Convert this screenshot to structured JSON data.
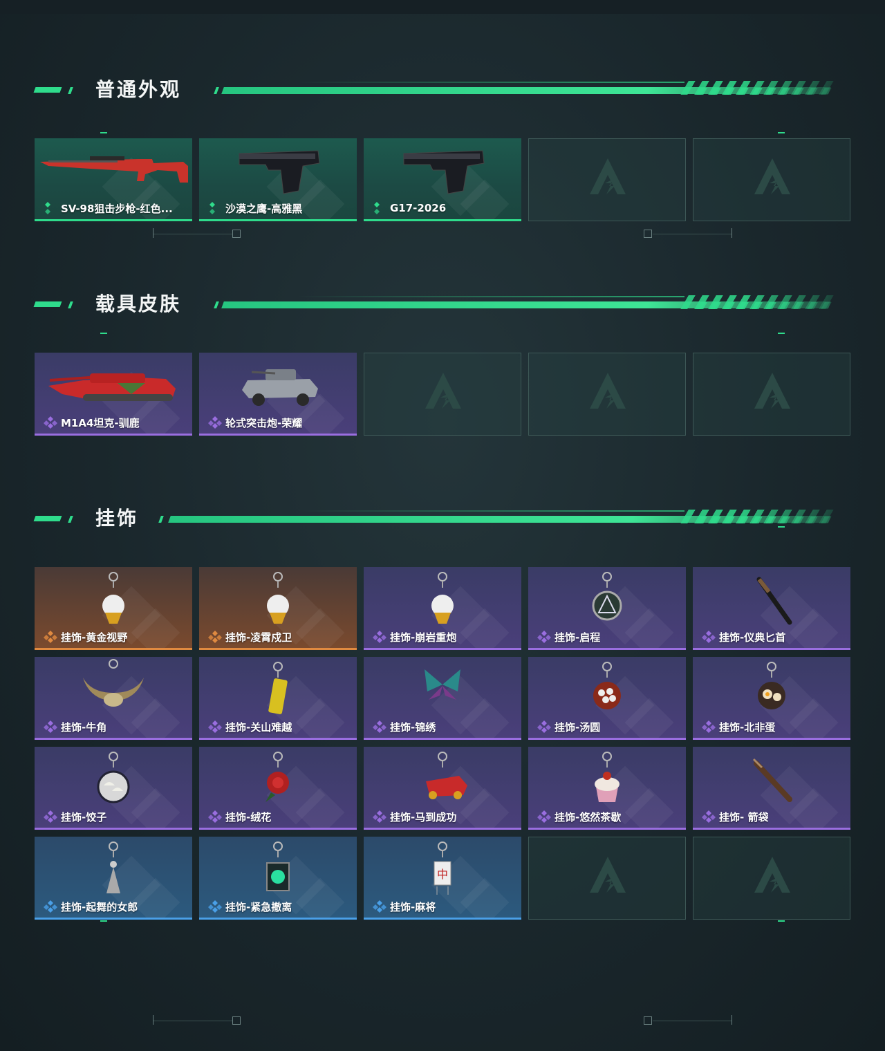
{
  "sections": [
    {
      "title": "普通外观",
      "cards": [
        {
          "label": "SV-98狙击步枪-红色...",
          "rarity": "green",
          "icon": "sniper-rifle-icon"
        },
        {
          "label": "沙漠之鹰-高雅黑",
          "rarity": "green",
          "icon": "pistol-icon"
        },
        {
          "label": "G17-2026",
          "rarity": "green",
          "icon": "pistol-icon"
        }
      ]
    },
    {
      "title": "载具皮肤",
      "cards": [
        {
          "label": "M1A4坦克-驯鹿",
          "rarity": "purple",
          "icon": "tank-icon"
        },
        {
          "label": "轮式突击炮-荣耀",
          "rarity": "purple",
          "icon": "armored-car-icon"
        }
      ]
    },
    {
      "title": "挂饰",
      "cards": [
        {
          "label": "挂饰-黄金视野",
          "rarity": "orange",
          "icon": "charm-figure-icon"
        },
        {
          "label": "挂饰-凌霄戍卫",
          "rarity": "orange",
          "icon": "charm-figure-icon"
        },
        {
          "label": "挂饰-崩岩重炮",
          "rarity": "purple",
          "icon": "charm-figure-icon"
        },
        {
          "label": "挂饰-启程",
          "rarity": "purple",
          "icon": "charm-medallion-icon"
        },
        {
          "label": "挂饰-仪典匕首",
          "rarity": "purple",
          "icon": "charm-dagger-icon"
        },
        {
          "label": "挂饰-牛角",
          "rarity": "purple",
          "icon": "charm-horns-icon"
        },
        {
          "label": "挂饰-关山难越",
          "rarity": "purple",
          "icon": "charm-bar-icon"
        },
        {
          "label": "挂饰-锦绣",
          "rarity": "purple",
          "icon": "charm-butterfly-icon"
        },
        {
          "label": "挂饰-汤圆",
          "rarity": "purple",
          "icon": "charm-bowl-icon"
        },
        {
          "label": "挂饰-北非蛋",
          "rarity": "purple",
          "icon": "charm-pan-icon"
        },
        {
          "label": "挂饰-饺子",
          "rarity": "purple",
          "icon": "charm-plate-icon"
        },
        {
          "label": "挂饰-绒花",
          "rarity": "purple",
          "icon": "charm-flower-icon"
        },
        {
          "label": "挂饰-马到成功",
          "rarity": "purple",
          "icon": "charm-horse-icon"
        },
        {
          "label": "挂饰-悠然茶歇",
          "rarity": "purple",
          "icon": "charm-cupcake-icon"
        },
        {
          "label": "挂饰- 箭袋",
          "rarity": "purple",
          "icon": "charm-quiver-icon"
        },
        {
          "label": "挂饰-起舞的女郎",
          "rarity": "blue",
          "icon": "charm-dancer-icon"
        },
        {
          "label": "挂饰-紧急撤离",
          "rarity": "blue",
          "icon": "charm-box-icon"
        },
        {
          "label": "挂饰-麻将",
          "rarity": "blue",
          "icon": "charm-mahjong-icon"
        }
      ]
    }
  ],
  "colors": {
    "accent": "#2fdc8c",
    "rarity_green": "#2fdc8c",
    "rarity_purple": "#9a6ee0",
    "rarity_orange": "#e08a40",
    "rarity_blue": "#4aa0e8"
  }
}
